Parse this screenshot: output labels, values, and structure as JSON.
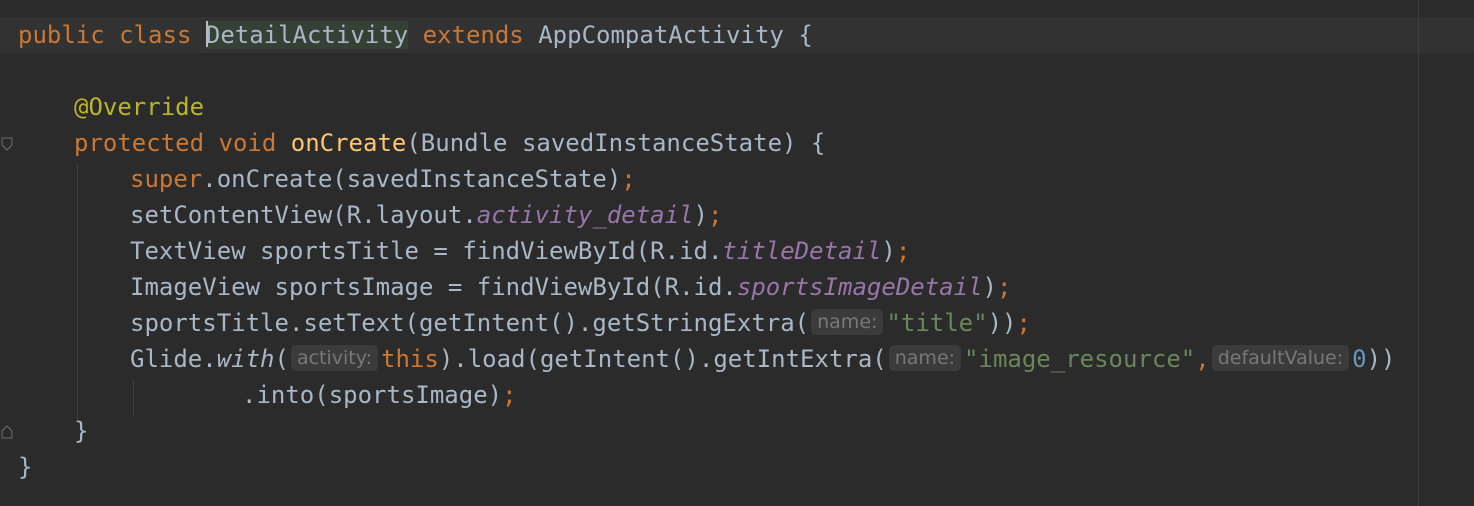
{
  "editor": {
    "language": "Java",
    "colors": {
      "background": "#2b2b2b",
      "keyword": "#cc7832",
      "annotation": "#bbb529",
      "method_decl": "#ffc66d",
      "field": "#9876aa",
      "string": "#6a8759",
      "number": "#6897bb",
      "text": "#a9b7c6",
      "hint_bg": "#3b3b3b",
      "hint_text": "#787878"
    },
    "code": {
      "l1": {
        "kw_public": "public",
        "kw_class": "class",
        "class_first": "D",
        "class_rest": "etailActivity",
        "kw_extends": "extends",
        "parent": "AppCompatActivity",
        "brace": "{"
      },
      "l3": {
        "annotation": "@Override"
      },
      "l4": {
        "kw_protected": "protected",
        "kw_void": "void",
        "method": "onCreate",
        "params": "(Bundle savedInstanceState) {"
      },
      "l5": {
        "kw_super": "super",
        "rest": ".onCreate(savedInstanceState)",
        "semi": ";"
      },
      "l6": {
        "pre": "setContentView(R.layout.",
        "field": "activity_detail",
        "post": ")",
        "semi": ";"
      },
      "l7": {
        "pre": "TextView sportsTitle = findViewById(R.id.",
        "field": "titleDetail",
        "post": ")",
        "semi": ";"
      },
      "l8": {
        "pre": "ImageView sportsImage = findViewById(R.id.",
        "field": "sportsImageDetail",
        "post": ")",
        "semi": ";"
      },
      "l9": {
        "pre": "sportsTitle.setText(getIntent().getStringExtra(",
        "hint": "name:",
        "string": "\"title\"",
        "post": "))",
        "semi": ";"
      },
      "l10": {
        "glide": "Glide.",
        "with": "with",
        "open": "(",
        "hint1": "activity:",
        "kw_this": "this",
        "mid": ").load(getIntent().getIntExtra(",
        "hint2": "name:",
        "string": "\"image_resource\"",
        "comma": ",",
        "hint3": "defaultValue:",
        "number": "0",
        "post": "))"
      },
      "l11": {
        "text": ".into(sportsImage)",
        "semi": ";"
      },
      "l12": {
        "brace": "}"
      },
      "l13": {
        "brace": "}"
      }
    }
  }
}
